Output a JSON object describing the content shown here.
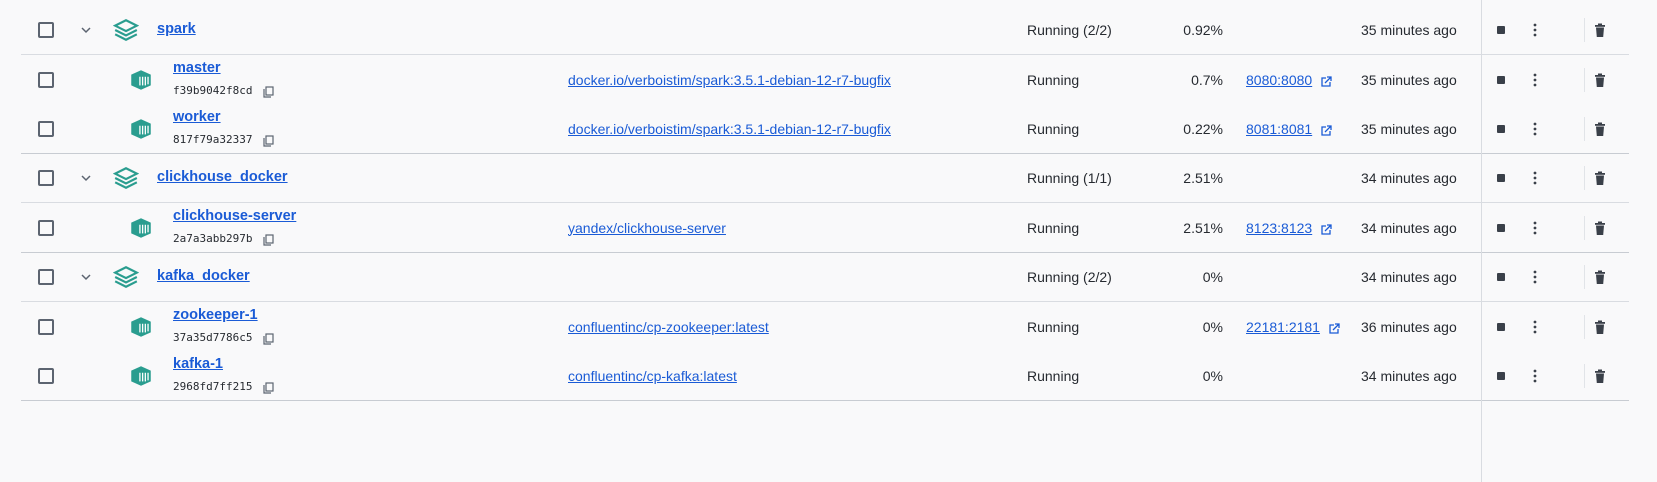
{
  "groups": [
    {
      "name": "spark",
      "status": "Running (2/2)",
      "cpu": "0.92%",
      "time": "35 minutes ago",
      "containers": [
        {
          "name": "master",
          "id": "f39b9042f8cd",
          "image": "docker.io/verboistim/spark:3.5.1-debian-12-r7-bugfix",
          "status": "Running",
          "cpu": "0.7%",
          "port": "8080:8080",
          "time": "35 minutes ago"
        },
        {
          "name": "worker",
          "id": "817f79a32337",
          "image": "docker.io/verboistim/spark:3.5.1-debian-12-r7-bugfix",
          "status": "Running",
          "cpu": "0.22%",
          "port": "8081:8081",
          "time": "35 minutes ago"
        }
      ]
    },
    {
      "name": "clickhouse_docker",
      "status": "Running (1/1)",
      "cpu": "2.51%",
      "time": "34 minutes ago",
      "containers": [
        {
          "name": "clickhouse-server",
          "id": "2a7a3abb297b",
          "image": "yandex/clickhouse-server",
          "status": "Running",
          "cpu": "2.51%",
          "port": "8123:8123",
          "time": "34 minutes ago"
        }
      ]
    },
    {
      "name": "kafka_docker",
      "status": "Running (2/2)",
      "cpu": "0%",
      "time": "34 minutes ago",
      "containers": [
        {
          "name": "zookeeper-1",
          "id": "37a35d7786c5",
          "image": "confluentinc/cp-zookeeper:latest",
          "status": "Running",
          "cpu": "0%",
          "port": "22181:2181",
          "time": "36 minutes ago"
        },
        {
          "name": "kafka-1",
          "id": "2968fd7ff215",
          "image": "confluentinc/cp-kafka:latest",
          "status": "Running",
          "cpu": "0%",
          "port": "",
          "time": "34 minutes ago"
        }
      ]
    }
  ],
  "icons": {
    "group": "stack-icon",
    "container": "container-icon",
    "copy": "copy-icon",
    "external": "external-link-icon",
    "stop": "stop-icon",
    "more": "more-vert-icon",
    "delete": "trash-icon",
    "expand": "chevron-down-icon"
  },
  "colors": {
    "link": "#1a5bd6",
    "icon_green": "#2a9d8f",
    "background": "#f9f9fa"
  }
}
